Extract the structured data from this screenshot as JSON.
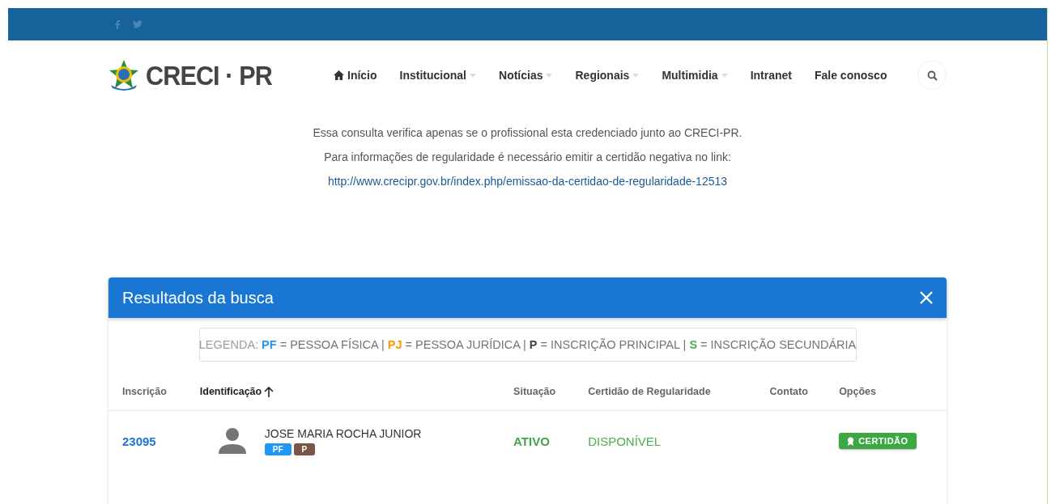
{
  "logo": {
    "text": "CRECI · PR"
  },
  "nav": [
    {
      "label": "Início",
      "kind": "home"
    },
    {
      "label": "Institucional",
      "kind": "menu"
    },
    {
      "label": "Notícias",
      "kind": "menu"
    },
    {
      "label": "Regionais",
      "kind": "menu"
    },
    {
      "label": "Multimidia",
      "kind": "menu"
    },
    {
      "label": "Intranet",
      "kind": "link"
    },
    {
      "label": "Fale conosco",
      "kind": "link"
    }
  ],
  "notice": {
    "lines": [
      "Essa consulta verifica apenas se o profissional esta credenciado junto ao CRECI-PR.",
      "Para informações de regularidade é necessário emitir a certidão negativa no link:"
    ],
    "link": "http://www.crecipr.gov.br/index.php/emissao-da-certidao-de-regularidade-12513"
  },
  "results": {
    "title": "Resultados da busca",
    "legend": [
      {
        "text": "LEGENDA: ",
        "color": "#9e9e9e"
      },
      {
        "text": "**PF**",
        "color": "#2196f3"
      },
      {
        "text": " = PESSOA FÍSICA | ",
        "color": "#757575"
      },
      {
        "text": "**PJ**",
        "color": "#ff9800"
      },
      {
        "text": " = PESSOA JURÍDICA | ",
        "color": "#757575"
      },
      {
        "text": "**P**",
        "color": "#424242"
      },
      {
        "text": " = INSCRIÇÃO PRINCIPAL | ",
        "color": "#757575"
      },
      {
        "text": "**S**",
        "color": "#4caf50"
      },
      {
        "text": " = INSCRIÇÃO SECUNDÁRIA",
        "color": "#757575"
      }
    ],
    "columns": [
      {
        "label": "Inscrição",
        "sorted": false
      },
      {
        "label": "Identificação",
        "sorted": true
      },
      {
        "label": "Situação",
        "sorted": false
      },
      {
        "label": "Certidão de Regularidade",
        "sorted": false
      },
      {
        "label": "Contato",
        "sorted": false
      },
      {
        "label": "Opções",
        "sorted": false
      }
    ],
    "rows": [
      {
        "inscricao": "23095",
        "name": "JOSE MARIA ROCHA JUNIOR",
        "tags": [
          {
            "text": "PF",
            "color": "#2196f3"
          },
          {
            "text": "P",
            "color": "#795548"
          }
        ],
        "situacao": "ATIVO",
        "certidao": "DISPONÍVEL",
        "button": "CERTIDÃO"
      }
    ]
  }
}
